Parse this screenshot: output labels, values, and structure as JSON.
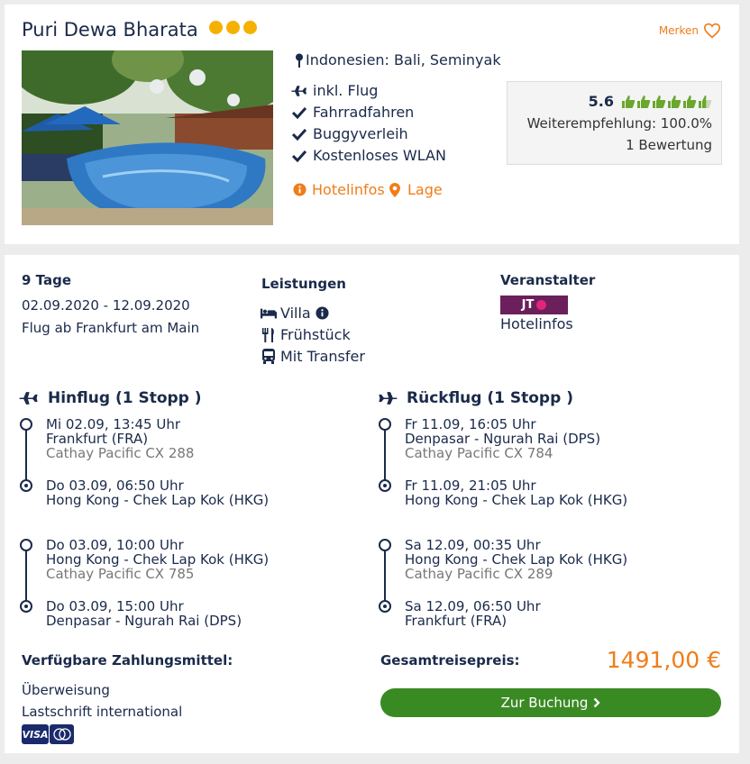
{
  "hotel": {
    "name": "Puri Dewa Bharata",
    "stars": 3,
    "merken_label": "Merken",
    "location": "Indonesien: Bali, Seminyak",
    "features": [
      "inkl. Flug",
      "Fahrradfahren",
      "Buggyverleih",
      "Kostenloses WLAN"
    ],
    "link_hotelinfos": "Hotelinfos",
    "link_lage": "Lage",
    "rating": {
      "score": "5.6",
      "thumbs_total": 6,
      "thumbs_filled_fraction": 0.93,
      "recommendation": "Weiterempfehlung: 100.0%",
      "reviews": "1 Bewertung"
    }
  },
  "offer": {
    "duration": "9 Tage",
    "dates": "02.09.2020 - 12.09.2020",
    "departure": "Flug ab Frankfurt am Main",
    "services_title": "Leistungen",
    "services": [
      "Villa",
      "Frühstück",
      "Mit Transfer"
    ],
    "operator_title": "Veranstalter",
    "operator_logo_text": "JT",
    "operator_link": "Hotelinfos",
    "outbound": {
      "title": "Hinflug (1 Stopp )",
      "legs": [
        {
          "dep_time": "Mi 02.09, 13:45 Uhr",
          "dep_airport": "Frankfurt (FRA)",
          "carrier": "Cathay Pacific CX 288",
          "arr_time": "Do 03.09, 06:50 Uhr",
          "arr_airport": "Hong Kong - Chek Lap Kok (HKG)"
        },
        {
          "dep_time": "Do 03.09, 10:00 Uhr",
          "dep_airport": "Hong Kong - Chek Lap Kok (HKG)",
          "carrier": "Cathay Pacific CX 785",
          "arr_time": "Do 03.09, 15:00 Uhr",
          "arr_airport": "Denpasar - Ngurah Rai (DPS)"
        }
      ]
    },
    "return": {
      "title": "Rückflug (1 Stopp )",
      "legs": [
        {
          "dep_time": "Fr 11.09, 16:05 Uhr",
          "dep_airport": "Denpasar - Ngurah Rai (DPS)",
          "carrier": "Cathay Pacific CX 784",
          "arr_time": "Fr 11.09, 21:05 Uhr",
          "arr_airport": "Hong Kong - Chek Lap Kok (HKG)"
        },
        {
          "dep_time": "Sa 12.09, 00:35 Uhr",
          "dep_airport": "Hong Kong - Chek Lap Kok (HKG)",
          "carrier": "Cathay Pacific CX 289",
          "arr_time": "Sa 12.09, 06:50 Uhr",
          "arr_airport": "Frankfurt (FRA)"
        }
      ]
    },
    "payment_title": "Verfügbare Zahlungsmittel:",
    "payment_methods": [
      "Überweisung",
      "Lastschrift international"
    ],
    "payment_logos": [
      "VISA",
      "mastercard"
    ],
    "price_label": "Gesamtreisepreis:",
    "price": "1491,00 €",
    "book_label": "Zur Buchung"
  },
  "colors": {
    "navy": "#1a2a4a",
    "accent": "#f07d19",
    "book_green": "#3a8a24",
    "star": "#f5b100",
    "thumb": "#6aa72e",
    "operator": "#6b1f5b"
  }
}
